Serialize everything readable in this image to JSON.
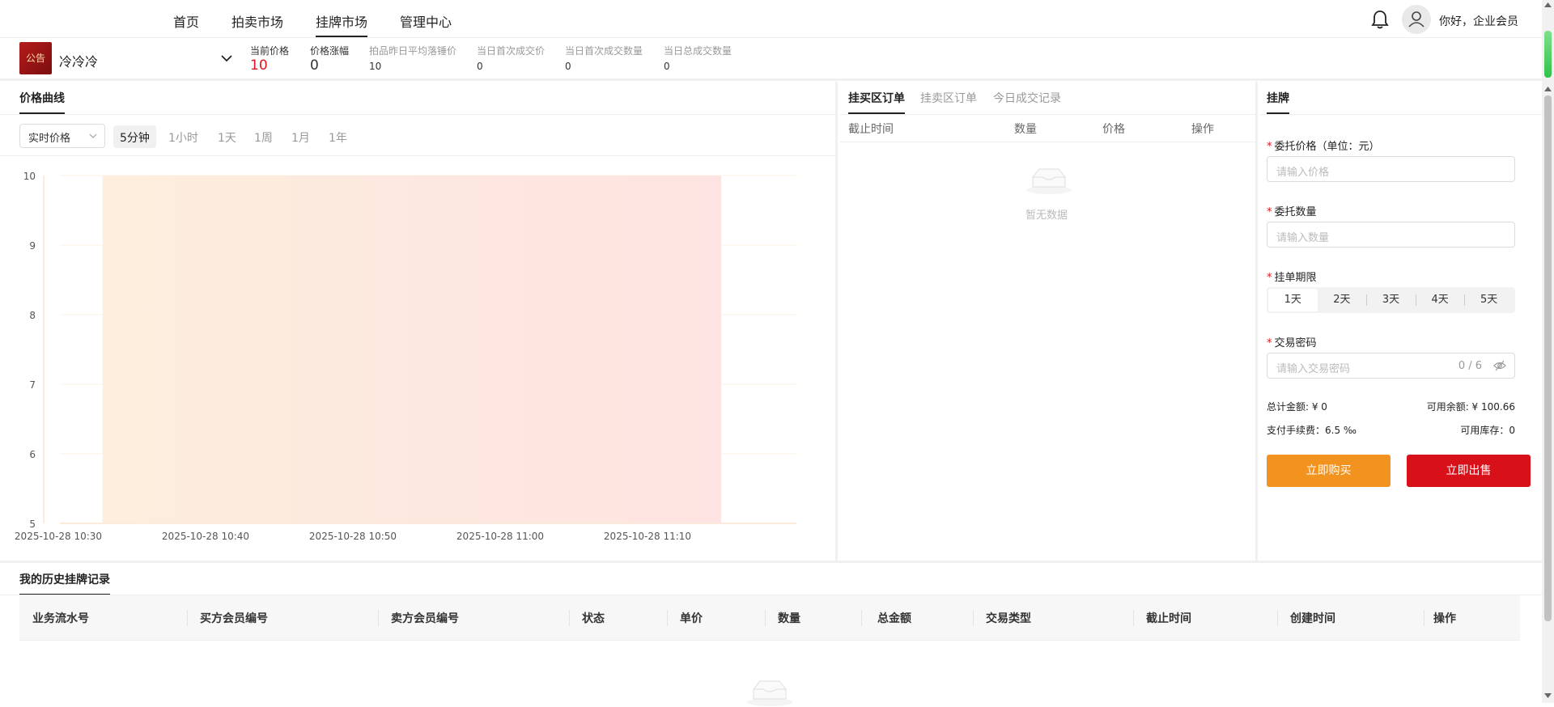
{
  "nav": {
    "items": [
      {
        "label": "首页",
        "active": false
      },
      {
        "label": "拍卖市场",
        "active": false
      },
      {
        "label": "挂牌市场",
        "active": true
      },
      {
        "label": "管理中心",
        "active": false
      }
    ],
    "icons": {
      "bell": "bell-icon",
      "avatar": "user-avatar-icon"
    },
    "greeting": "你好，企业会员"
  },
  "product": {
    "logo_text": "公告",
    "name": "冷冷冷",
    "dropdown_icon": "chevron-down-icon"
  },
  "stats": [
    {
      "label": "当前价格",
      "value": "10"
    },
    {
      "label": "价格涨幅",
      "value": "0"
    },
    {
      "label": "拍品昨日平均落锤价",
      "value": "10"
    },
    {
      "label": "当日首次成交价",
      "value": "0"
    },
    {
      "label": "当日首次成交数量",
      "value": "0"
    },
    {
      "label": "当日总成交数量",
      "value": "0"
    }
  ],
  "chart_panel": {
    "title": "价格曲线",
    "price_type_select": "实时价格",
    "ranges": [
      "5分钟",
      "1小时",
      "1天",
      "1周",
      "1月",
      "1年"
    ],
    "active_range": "5分钟"
  },
  "chart_data": {
    "type": "area",
    "title": "",
    "xlabel": "",
    "ylabel": "",
    "x": [
      "2025-10-28 10:33",
      "2025-10-28 11:15"
    ],
    "series": [
      {
        "values": [
          10,
          10
        ]
      }
    ],
    "ylim": [
      5,
      10
    ],
    "yticks": [
      10,
      9,
      8,
      7,
      6,
      5
    ],
    "xticks": [
      "2025-10-28 10:30",
      "2025-10-28 10:40",
      "2025-10-28 10:50",
      "2025-10-28 11:00",
      "2025-10-28 11:10"
    ],
    "grid": true,
    "colors": {
      "line_start": "#f2c38a",
      "line_end": "#c8141e",
      "fill_start": "#fdeedd",
      "fill_end": "#fde3e1"
    }
  },
  "orders_panel": {
    "tabs": [
      {
        "label": "挂买区订单",
        "active": true
      },
      {
        "label": "挂卖区订单",
        "active": false
      },
      {
        "label": "今日成交记录",
        "active": false
      }
    ],
    "columns": [
      "截止时间",
      "数量",
      "价格",
      "操作"
    ],
    "empty_text": "暂无数据",
    "empty_icon": "empty-inbox-icon"
  },
  "form_panel": {
    "title": "挂牌",
    "price_label": "委托价格（单位：元）",
    "price_placeholder": "请输入价格",
    "qty_label": "委托数量",
    "qty_placeholder": "请输入数量",
    "period_label": "挂单期限",
    "periods": [
      "1天",
      "2天",
      "3天",
      "4天",
      "5天"
    ],
    "active_period": "1天",
    "pwd_label": "交易密码",
    "pwd_placeholder": "请输入交易密码",
    "pwd_count": "0 / 6",
    "pwd_toggle_icon": "eye-off-icon",
    "total_amount": "总计金额: ¥ 0",
    "available_balance": "可用余额: ¥ 100.66",
    "fee": "支付手续费：6.5 ‰",
    "available_stock": "可用库存：0",
    "buy_button": "立即购买",
    "sell_button": "立即出售",
    "colors": {
      "buy": "#f2921f",
      "sell": "#d8101a",
      "price_red": "#e0141e"
    }
  },
  "history": {
    "title": "我的历史挂牌记录",
    "columns": [
      "业务流水号",
      "买方会员编号",
      "卖方会员编号",
      "状态",
      "单价",
      "数量",
      "总金额",
      "交易类型",
      "截止时间",
      "创建时间",
      "操作"
    ]
  }
}
